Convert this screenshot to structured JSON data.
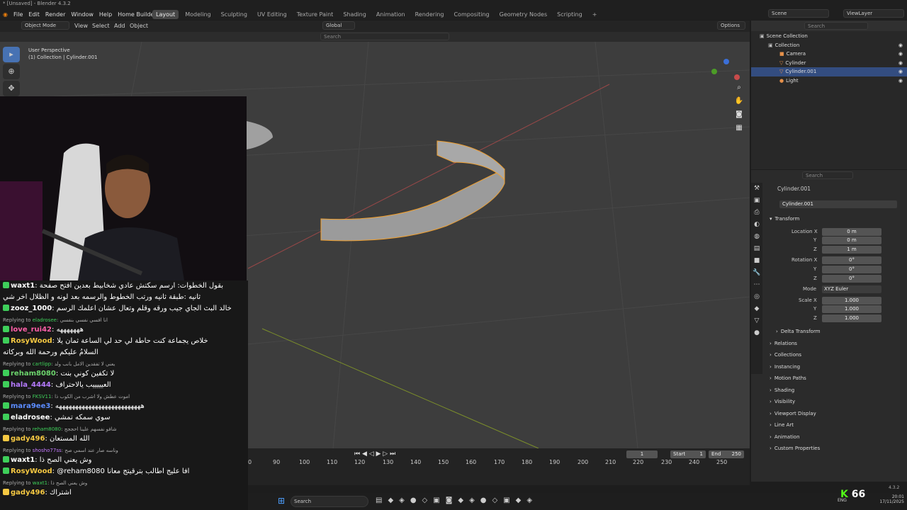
{
  "window_title": "* [Unsaved] - Blender 4.3.2",
  "menus": [
    "File",
    "Edit",
    "Render",
    "Window",
    "Help",
    "Home Builder"
  ],
  "workspaces": [
    "Layout",
    "Modeling",
    "Sculpting",
    "UV Editing",
    "Texture Paint",
    "Shading",
    "Animation",
    "Rendering",
    "Compositing",
    "Geometry Nodes",
    "Scripting"
  ],
  "active_workspace": "Layout",
  "scene_label": "Scene",
  "view_layer_label": "ViewLayer",
  "header": {
    "mode": "Object Mode",
    "view": "View",
    "select": "Select",
    "add": "Add",
    "object": "Object",
    "orientation": "Global",
    "options": "Options",
    "search_placeholder": "Search"
  },
  "viewport_info": {
    "line1": "User Perspective",
    "line2": "(1) Collection | Cylinder.001"
  },
  "outliner": {
    "search_placeholder": "Search",
    "root": "Scene Collection",
    "items": [
      {
        "label": "Collection",
        "selected": false,
        "indent": 1
      },
      {
        "label": "Camera",
        "selected": false,
        "indent": 2
      },
      {
        "label": "Cylinder",
        "selected": false,
        "indent": 2
      },
      {
        "label": "Cylinder.001",
        "selected": true,
        "indent": 2
      },
      {
        "label": "Light",
        "selected": false,
        "indent": 2
      }
    ]
  },
  "properties": {
    "search_placeholder": "Search",
    "object_name": "Cylinder.001",
    "object_field": "Cylinder.001",
    "transform_title": "Transform",
    "location": {
      "label": "Location X",
      "x": "0 m",
      "y": "0 m",
      "z": "1 m"
    },
    "rotation": {
      "label": "Rotation X",
      "x": "0°",
      "y": "0°",
      "z": "0°"
    },
    "mode_label": "Mode",
    "mode_value": "XYZ Euler",
    "scale": {
      "label": "Scale X",
      "x": "1.000",
      "y": "1.000",
      "z": "1.000"
    },
    "axis_y": "Y",
    "axis_z": "Z",
    "delta": "Delta Transform",
    "sections": [
      "Relations",
      "Collections",
      "Instancing",
      "Motion Paths",
      "Shading",
      "Visibility",
      "Viewport Display",
      "Line Art",
      "Animation",
      "Custom Properties"
    ]
  },
  "timeline": {
    "current": "1",
    "start_label": "Start",
    "start": "1",
    "end_label": "End",
    "end": "250",
    "frames": [
      "0",
      "90",
      "100",
      "110",
      "120",
      "130",
      "140",
      "150",
      "160",
      "170",
      "180",
      "190",
      "200",
      "210",
      "220",
      "230",
      "240",
      "250"
    ]
  },
  "taskbar": {
    "search": "Search",
    "lang": "ENG",
    "time": "20:01",
    "date": "17/11/2025",
    "version": "4.3.2"
  },
  "kick_count": "66",
  "chat": [
    {
      "type": "msg",
      "name": "waxt1",
      "color": "#ffffff",
      "text": "بقول الخطوات: ارسم سكتش عادي شخابيط بعدين افتح صفحة"
    },
    {
      "type": "cont",
      "text": "ثانيه :طبقة ثانيه ورتب الخطوط والرسمه بعد لونه و الظلال اخر شي"
    },
    {
      "type": "msg",
      "name": "zooz_1000",
      "color": "#ffffff",
      "text": "خالد البث الجاي جيب ورقه وقلم وتعال عشان اعلمك الرسم"
    },
    {
      "type": "msg",
      "name": "love_rui42",
      "color": "#ff5fa8",
      "text": "هههههههه"
    },
    {
      "type": "reply",
      "to": "eladrosee",
      "text": "انا افسي نفسي بنفسي"
    },
    {
      "type": "msg",
      "name": "RosyWood",
      "color": "#f5c842",
      "text": "خلاص يجماعة كنت حاطة لي حد لي الساعة ثمان يلا"
    },
    {
      "type": "cont",
      "text": "السلامُ عليكم ورحمة الله وبركاته"
    },
    {
      "type": "reply",
      "to": "cartlipp",
      "text": "يعني لا تفقدين الامل بانب ولد"
    },
    {
      "type": "msg",
      "name": "reham8080",
      "color": "#6cd46c",
      "text": "لا تكفين كوني بنت"
    },
    {
      "type": "msg",
      "name": "hala_4444",
      "color": "#b57aff",
      "text": "العيييييب يالاحتراف"
    },
    {
      "type": "reply",
      "to": "FKSV11",
      "text": "اموت عطش ولا اشرب من الكوب ذا"
    },
    {
      "type": "msg",
      "name": "mara9ee3",
      "color": "#5b8cff",
      "text": "ههههههههههههههههههههههههههه"
    },
    {
      "type": "msg",
      "name": "eladrosee",
      "color": "#ffffff",
      "text": "سوي سمكه تمشي"
    },
    {
      "type": "reply",
      "to": "reham8080",
      "text": "شافو نفسهم علينا احججج"
    },
    {
      "type": "msg",
      "name": "gady496",
      "color": "#f5c842",
      "text": "الله المستعان"
    },
    {
      "type": "reply",
      "to": "shosho77ss",
      "text": "وناسه صار عند اسمي صح"
    },
    {
      "type": "msg",
      "name": "waxt1",
      "color": "#ffffff",
      "text": "وش يعني الصح ذا"
    },
    {
      "type": "msg",
      "name": "RosyWood",
      "color": "#f5c842",
      "text": "@reham8080 افا عليج اطالب بترقيتج معانا"
    },
    {
      "type": "reply",
      "to": "waxt1",
      "text": "وش يعني الصح ذا"
    },
    {
      "type": "msg",
      "name": "gady496",
      "color": "#f5c842",
      "text": "اشتراك"
    }
  ],
  "colors": {
    "accent": "#4772b3",
    "selection": "#334d80",
    "object_outline": "#f0a030",
    "kick_green": "#53fc18"
  }
}
